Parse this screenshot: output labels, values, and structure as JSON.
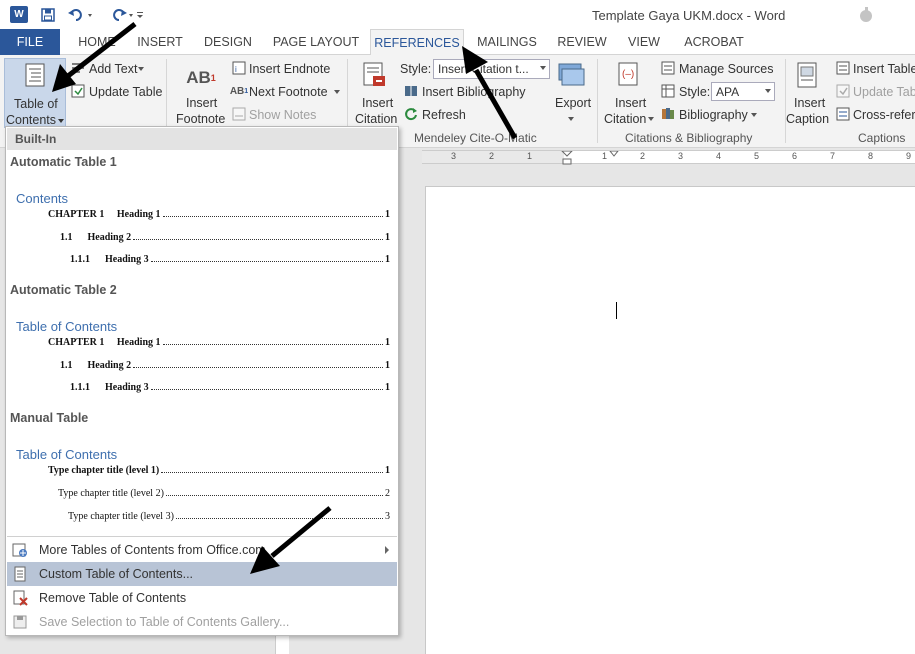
{
  "app": {
    "title": "Template Gaya UKM.docx - Word",
    "logo": "W"
  },
  "quick_access": {
    "icons": [
      "word-logo",
      "save-icon",
      "undo-icon",
      "redo-icon",
      "customize-icon"
    ]
  },
  "tabs": [
    {
      "label": "FILE"
    },
    {
      "label": "HOME"
    },
    {
      "label": "INSERT"
    },
    {
      "label": "DESIGN"
    },
    {
      "label": "PAGE LAYOUT"
    },
    {
      "label": "REFERENCES"
    },
    {
      "label": "MAILINGS"
    },
    {
      "label": "REVIEW"
    },
    {
      "label": "VIEW"
    },
    {
      "label": "ACROBAT"
    }
  ],
  "active_tab": "REFERENCES",
  "ribbon": {
    "toc": {
      "label_line1": "Table of",
      "label_line2": "Contents",
      "add_text": "Add Text",
      "update_table": "Update Table"
    },
    "footnotes": {
      "insert_footnote_1": "Insert",
      "insert_footnote_2": "Footnote",
      "insert_endnote": "Insert Endnote",
      "next_footnote": "Next Footnote",
      "show_notes": "Show Notes"
    },
    "mendeley": {
      "insert_citation_1": "Insert",
      "insert_citation_2": "Citation",
      "style_label": "Style:",
      "style_value": "Insert Citation t...",
      "insert_bibliography": "Insert Bibliography",
      "refresh": "Refresh",
      "export": "Export",
      "group_label": "Mendeley Cite-O-Matic"
    },
    "citations": {
      "insert_citation_1": "Insert",
      "insert_citation_2": "Citation",
      "manage_sources": "Manage Sources",
      "style_label": "Style:",
      "style_value": "APA",
      "bibliography": "Bibliography",
      "group_label": "Citations & Bibliography"
    },
    "captions": {
      "insert_caption_1": "Insert",
      "insert_caption_2": "Caption",
      "insert_table": "Insert Table",
      "update_table": "Update Tab",
      "cross_reference": "Cross-refere",
      "group_label": "Captions"
    }
  },
  "ruler": {
    "numbers": [
      "3",
      "2",
      "1",
      "1",
      "2",
      "3",
      "4",
      "5",
      "6",
      "7",
      "8",
      "9"
    ]
  },
  "toc_dropdown": {
    "header": "Built-In",
    "entries": [
      {
        "title": "Automatic Table 1",
        "heading": "Contents",
        "lines": [
          {
            "label": "CHAPTER 1     Heading 1",
            "page": "1",
            "bold": true
          },
          {
            "label": "1.1      Heading 2",
            "page": "1",
            "bold": true
          },
          {
            "label": "1.1.1      Heading 3",
            "page": "1",
            "bold": true
          }
        ]
      },
      {
        "title": "Automatic Table 2",
        "heading": "Table of Contents",
        "lines": [
          {
            "label": "CHAPTER 1     Heading 1",
            "page": "1",
            "bold": true
          },
          {
            "label": "1.1      Heading 2",
            "page": "1",
            "bold": true
          },
          {
            "label": "1.1.1      Heading 3",
            "page": "1",
            "bold": true
          }
        ]
      },
      {
        "title": "Manual Table",
        "heading": "Table of Contents",
        "lines": [
          {
            "label": "Type chapter title (level 1)",
            "page": "1",
            "bold": true
          },
          {
            "label": "Type chapter title (level 2)",
            "page": "2",
            "bold": false
          },
          {
            "label": "Type chapter title (level 3)",
            "page": "3",
            "bold": false
          }
        ]
      }
    ],
    "menu": [
      {
        "label": "More Tables of Contents from Office.com",
        "icon": "office-web-icon"
      },
      {
        "label": "Custom Table of Contents...",
        "icon": "document-icon"
      },
      {
        "label": "Remove Table of Contents",
        "icon": "remove-toc-icon"
      },
      {
        "label": "Save Selection to Table of Contents Gallery...",
        "icon": "save-gallery-icon"
      }
    ]
  },
  "colors": {
    "accent": "#2b579a",
    "toc_heading": "#3e6fae",
    "highlight": "#b8c4d6"
  }
}
